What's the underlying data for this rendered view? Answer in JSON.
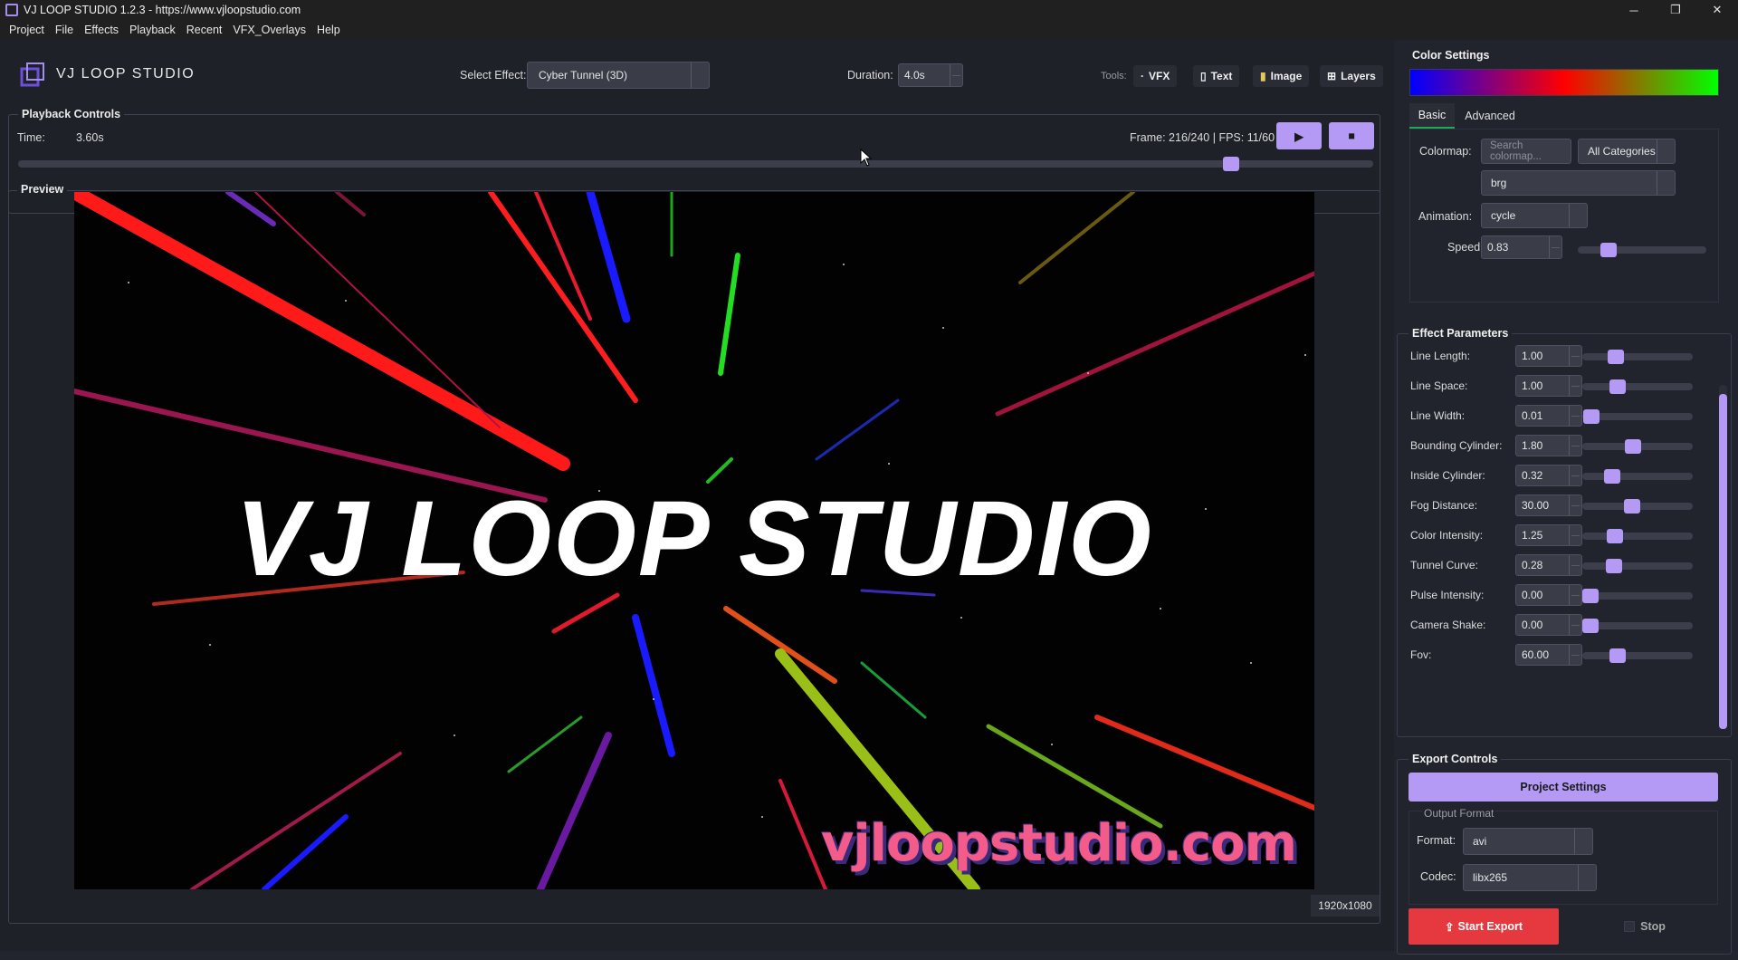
{
  "window": {
    "title": "VJ LOOP STUDIO 1.2.3 - https://www.vjloopstudio.com",
    "controls": {
      "minimize": "─",
      "maximize": "❐",
      "close": "✕"
    }
  },
  "menu": [
    "Project",
    "File",
    "Effects",
    "Playback",
    "Recent",
    "VFX_Overlays",
    "Help"
  ],
  "header": {
    "logo_text": "VJ LOOP STUDIO",
    "select_effect_label": "Select Effect:",
    "select_effect_value": "Cyber Tunnel (3D)",
    "duration_label": "Duration:",
    "duration_value": "4.0s",
    "tools_label": "Tools:",
    "tools": [
      {
        "label": "VFX",
        "icon": "·"
      },
      {
        "label": "Text",
        "icon": "▯"
      },
      {
        "label": "Image",
        "icon": "▮"
      },
      {
        "label": "Layers",
        "icon": "⊞"
      }
    ]
  },
  "playback": {
    "title": "Playback Controls",
    "time_label": "Time:",
    "time_value": "3.60s",
    "frame_info": "Frame: 216/240 | FPS: 11/60",
    "play_icon": "▶",
    "stop_icon": "■",
    "progress": 0.9
  },
  "preview": {
    "title": "Preview",
    "overlay_text": "VJ LOOP STUDIO",
    "watermark": "vjloopstudio.com",
    "resolution": "1920x1080"
  },
  "color_settings": {
    "title": "Color Settings",
    "tabs": [
      "Basic",
      "Advanced"
    ],
    "active_tab": "Basic",
    "colormap_label": "Colormap:",
    "search_placeholder": "Search colormap...",
    "category_value": "All Categories",
    "colormap_value": "brg",
    "animation_label": "Animation:",
    "animation_value": "cycle",
    "speed_label": "Speed:",
    "speed_value": "0.83",
    "speed_fraction": 0.2
  },
  "effect_parameters": {
    "title": "Effect Parameters",
    "params": [
      {
        "label": "Line Length:",
        "value": "1.00",
        "fraction": 0.27
      },
      {
        "label": "Line Space:",
        "value": "1.00",
        "fraction": 0.29
      },
      {
        "label": "Line Width:",
        "value": "0.01",
        "fraction": 0.01
      },
      {
        "label": "Bounding Cylinder:",
        "value": "1.80",
        "fraction": 0.45
      },
      {
        "label": "Inside Cylinder:",
        "value": "0.32",
        "fraction": 0.23
      },
      {
        "label": "Fog Distance:",
        "value": "30.00",
        "fraction": 0.44
      },
      {
        "label": "Color Intensity:",
        "value": "1.25",
        "fraction": 0.26
      },
      {
        "label": "Tunnel Curve:",
        "value": "0.28",
        "fraction": 0.25
      },
      {
        "label": "Pulse Intensity:",
        "value": "0.00",
        "fraction": 0.0
      },
      {
        "label": "Camera Shake:",
        "value": "0.00",
        "fraction": 0.0
      },
      {
        "label": "Fov:",
        "value": "60.00",
        "fraction": 0.29
      }
    ]
  },
  "export": {
    "title": "Export Controls",
    "project_settings": "Project Settings",
    "output_format_label": "Output Format",
    "format_label": "Format:",
    "format_value": "avi",
    "codec_label": "Codec:",
    "codec_value": "libx265",
    "start_export": "Start Export",
    "stop": "Stop"
  },
  "colors": {
    "accent": "#b49af5",
    "danger": "#e5393f",
    "background": "#1f2128"
  }
}
